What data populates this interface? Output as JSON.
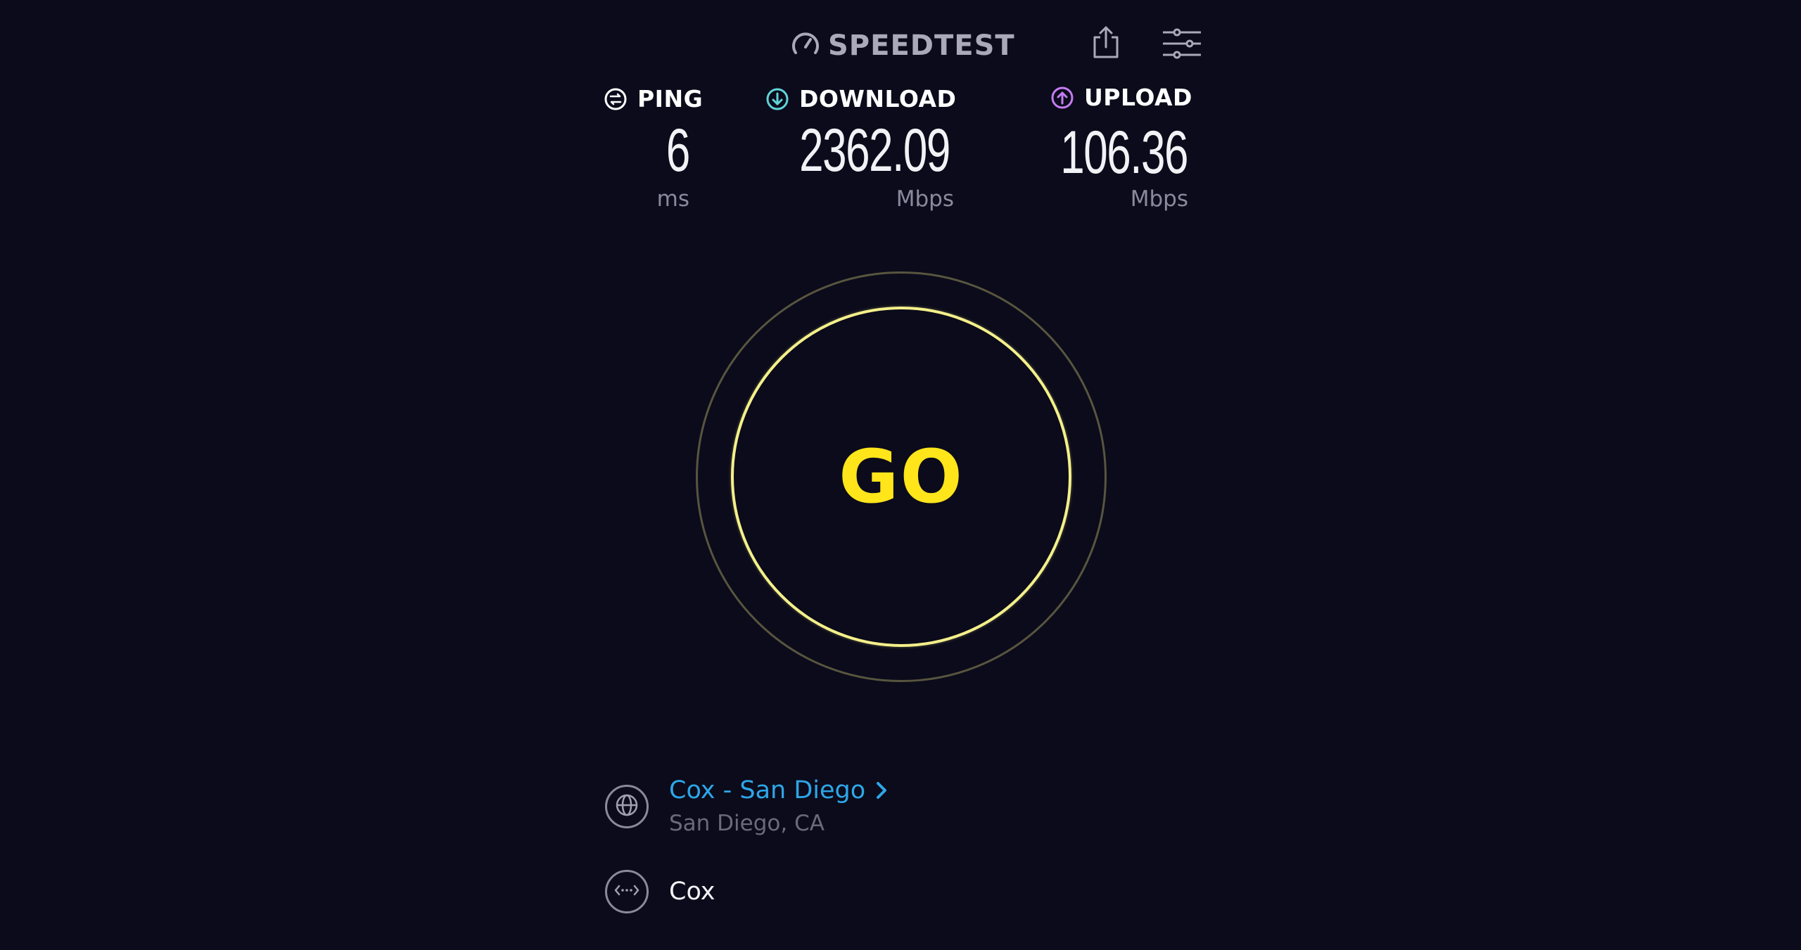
{
  "header": {
    "logo_text": "SPEEDTEST",
    "logo_icon": "speedometer-icon",
    "share_icon": "share-icon",
    "settings_icon": "sliders-icon"
  },
  "metrics": {
    "ping": {
      "label": "PING",
      "value": "6",
      "unit": "ms",
      "icon": "ping-icon",
      "color": "#ffffff"
    },
    "download": {
      "label": "DOWNLOAD",
      "value": "2362.09",
      "unit": "Mbps",
      "icon": "download-arrow-icon",
      "color": "#5fd4d8"
    },
    "upload": {
      "label": "UPLOAD",
      "value": "106.36",
      "unit": "Mbps",
      "icon": "upload-arrow-icon",
      "color": "#c47cf2"
    }
  },
  "go_button": {
    "label": "GO",
    "text_color": "#ffe51a",
    "ring_color": "#f4f08a"
  },
  "server": {
    "name": "Cox - San Diego",
    "location": "San Diego, CA",
    "icon": "globe-icon",
    "link_color": "#2ea6e8"
  },
  "isp": {
    "name": "Cox",
    "icon": "connection-icon"
  }
}
